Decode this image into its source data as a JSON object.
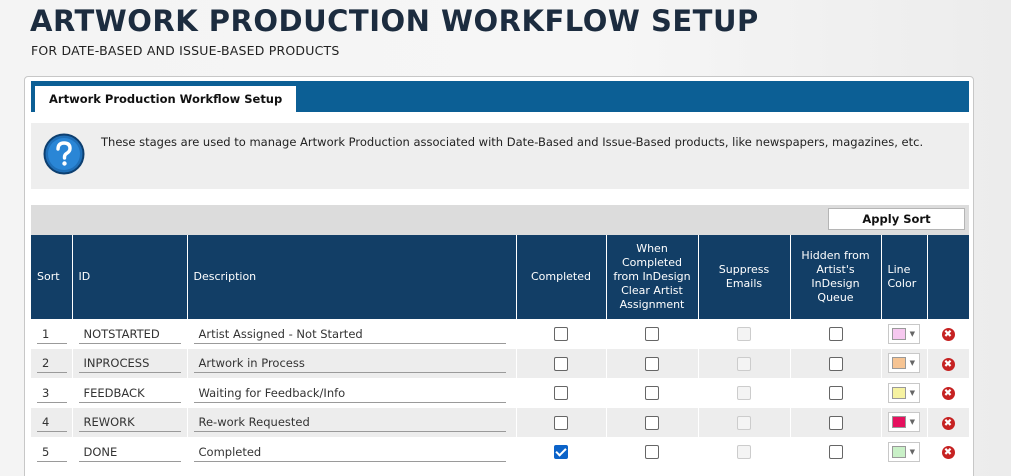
{
  "page": {
    "title": "ARTWORK PRODUCTION WORKFLOW SETUP",
    "subtitle": "FOR DATE-BASED AND ISSUE-BASED PRODUCTS"
  },
  "tab": {
    "label": "Artwork Production Workflow Setup"
  },
  "info": {
    "icon": "question-icon",
    "text": "These stages are used to manage Artwork Production associated with Date-Based and Issue-Based products, like newspapers, magazines, etc."
  },
  "toolbar": {
    "apply_sort_label": "Apply Sort"
  },
  "table": {
    "headers": {
      "sort": "Sort",
      "id": "ID",
      "description": "Description",
      "completed": "Completed",
      "clear_artist": "When Completed from InDesign Clear Artist Assignment",
      "suppress_emails": "Suppress Emails",
      "hidden_queue": "Hidden from Artist's InDesign Queue",
      "line_color": "Line Color"
    },
    "rows": [
      {
        "sort": "1",
        "id": "NOTSTARTED",
        "description": "Artist Assigned - Not Started",
        "completed": false,
        "clear_artist": false,
        "suppress_emails": false,
        "hidden_queue": false,
        "color": "#f6c8ef"
      },
      {
        "sort": "2",
        "id": "INPROCESS",
        "description": "Artwork in Process",
        "completed": false,
        "clear_artist": false,
        "suppress_emails": false,
        "hidden_queue": false,
        "color": "#f6c493"
      },
      {
        "sort": "3",
        "id": "FEEDBACK",
        "description": "Waiting for Feedback/Info",
        "completed": false,
        "clear_artist": false,
        "suppress_emails": false,
        "hidden_queue": false,
        "color": "#f6f2a1"
      },
      {
        "sort": "4",
        "id": "REWORK",
        "description": "Re-work Requested",
        "completed": false,
        "clear_artist": false,
        "suppress_emails": false,
        "hidden_queue": false,
        "color": "#e5115e"
      },
      {
        "sort": "5",
        "id": "DONE",
        "description": "Completed",
        "completed": true,
        "clear_artist": false,
        "suppress_emails": false,
        "hidden_queue": false,
        "color": "#c9f0c7"
      }
    ]
  },
  "colors": {
    "tab_bar": "#0c5f95",
    "header": "#123e66",
    "delete": "#c62222",
    "check": "#0b63c9"
  }
}
